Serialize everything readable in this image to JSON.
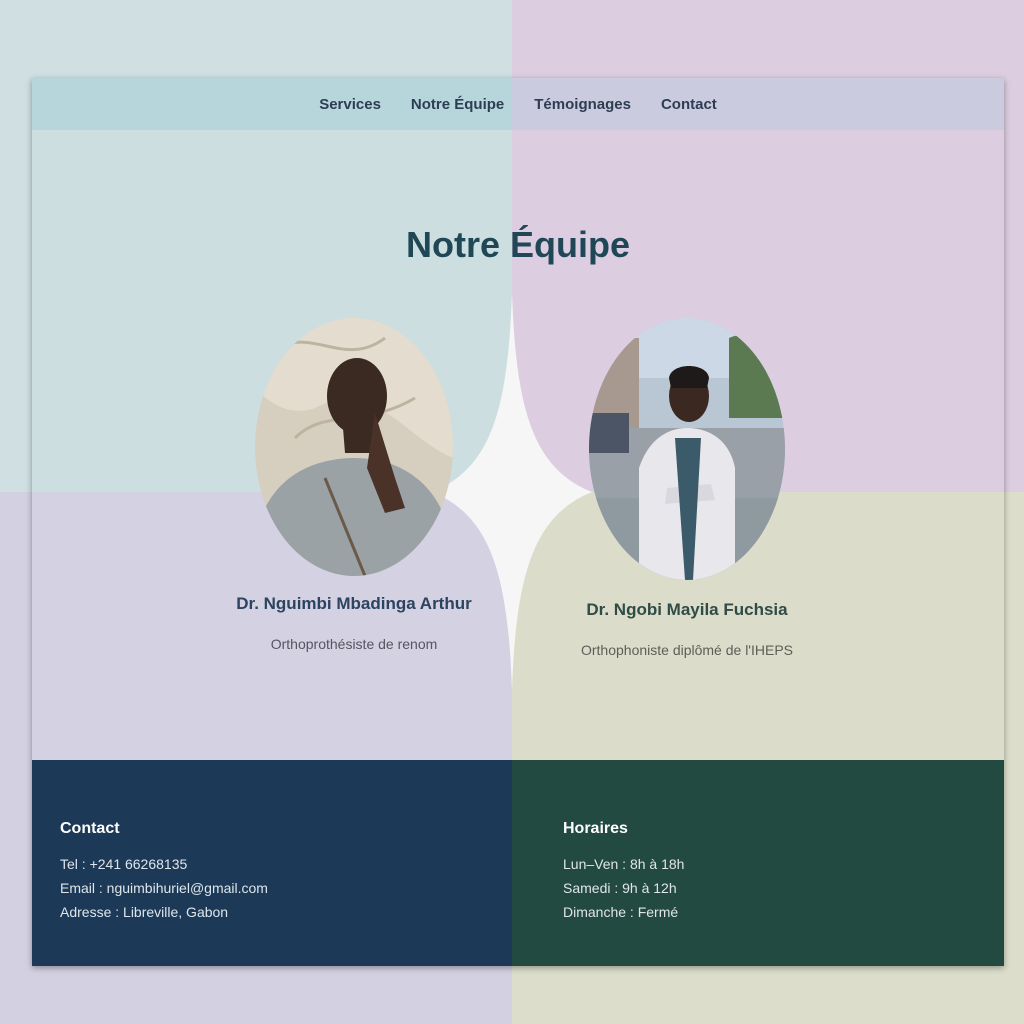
{
  "nav": {
    "items": [
      "Services",
      "Notre Équipe",
      "Témoignages",
      "Contact"
    ]
  },
  "team": {
    "title": "Notre Équipe",
    "members": [
      {
        "name": "Dr. Nguimbi Mbadinga Arthur",
        "role": "Orthoprothésiste de renom"
      },
      {
        "name": "Dr. Ngobi Mayila Fuchsia",
        "role": "Orthophoniste diplômé de l'IHEPS"
      }
    ]
  },
  "footer": {
    "contact": {
      "heading": "Contact",
      "lines": [
        "Tel : +241 66268135",
        "Email : nguimbihuriel@gmail.com",
        "Adresse : Libreville, Gabon"
      ]
    },
    "hours": {
      "heading": "Horaires",
      "lines": [
        "Lun–Ven : 8h à 18h",
        "Samedi : 9h à 12h",
        "Dimanche : Fermé"
      ]
    }
  },
  "colors": {
    "title": "#1f4756",
    "footer_left": "#1c3a58",
    "footer_right": "#234a40"
  }
}
